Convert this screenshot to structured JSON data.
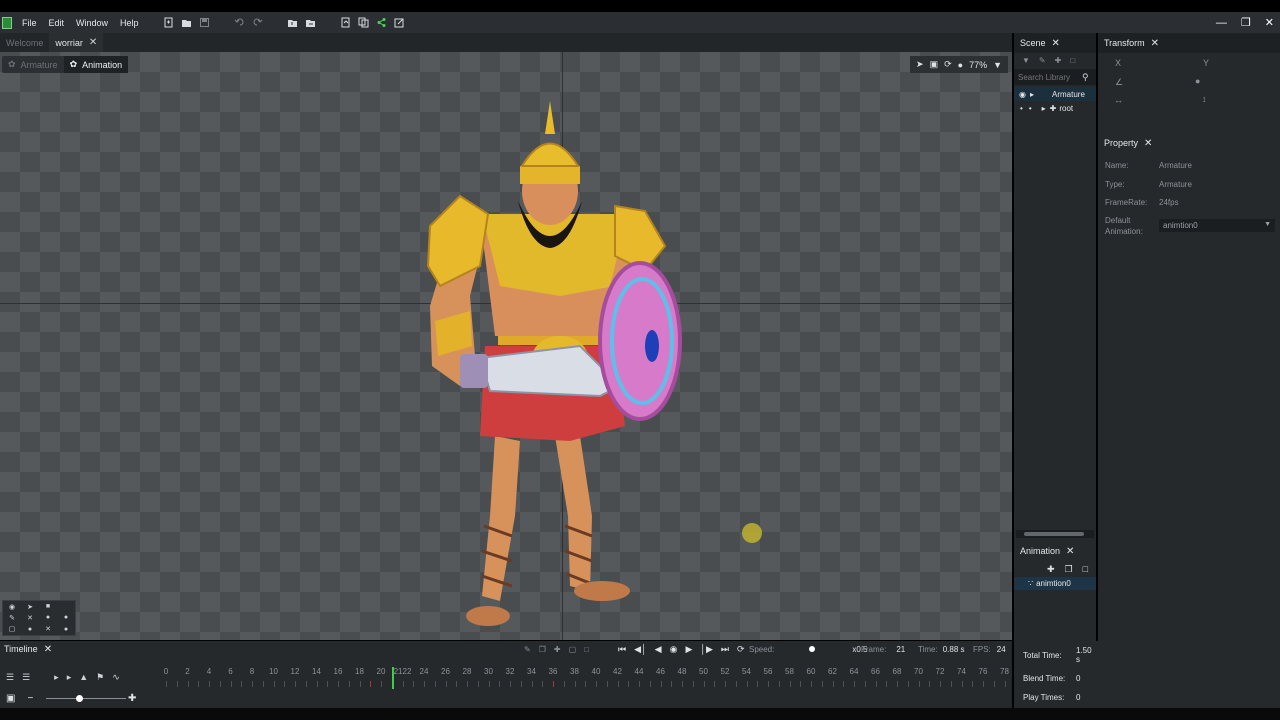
{
  "menu": [
    "File",
    "Edit",
    "Window",
    "Help"
  ],
  "doc_tabs": [
    {
      "label": "Welcome",
      "active": false
    },
    {
      "label": "worriar",
      "active": true
    }
  ],
  "viewport": {
    "mode_tabs": [
      {
        "label": "Armature",
        "active": false
      },
      {
        "label": "Animation",
        "active": true
      }
    ],
    "zoom": "77%"
  },
  "scene": {
    "title": "Scene",
    "search_placeholder": "Search Library",
    "tree": [
      {
        "label": "Armature",
        "selected": true
      },
      {
        "label": "root",
        "selected": false
      }
    ]
  },
  "animation_panel": {
    "title": "Animation",
    "items": [
      "animtion0"
    ]
  },
  "transform": {
    "title": "Transform",
    "x_label": "X",
    "y_label": "Y"
  },
  "property": {
    "title": "Property",
    "name_label": "Name:",
    "name_value": "Armature",
    "type_label": "Type:",
    "type_value": "Armature",
    "framerate_label": "FrameRate:",
    "framerate_value": "24fps",
    "default_anim_label_1": "Default",
    "default_anim_label_2": "Animation:",
    "default_anim_value": "animtion0"
  },
  "timeline": {
    "title": "Timeline",
    "speed_label": "Speed:",
    "speed_value": "x0.5",
    "speed_level": 0.5,
    "frame_label": "Frame:",
    "frame_value": "21",
    "time_label": "Time:",
    "time_value": "0.88 s",
    "fps_label": "FPS:",
    "fps_value": "24",
    "ruler_labels": [
      "0",
      "2",
      "4",
      "6",
      "8",
      "10",
      "12",
      "14",
      "16",
      "18",
      "20",
      "2122",
      "24",
      "26",
      "28",
      "30",
      "32",
      "34",
      "36",
      "38",
      "40",
      "42",
      "44",
      "46",
      "48",
      "50",
      "52",
      "54",
      "56",
      "58",
      "60",
      "62",
      "64",
      "66",
      "68",
      "70",
      "72",
      "74",
      "76",
      "78"
    ]
  },
  "stats": {
    "total_time_label": "Total Time:",
    "total_time_value": "1.50 s",
    "blend_time_label": "Blend Time:",
    "blend_time_value": "0",
    "play_times_label": "Play Times:",
    "play_times_value": "0"
  }
}
